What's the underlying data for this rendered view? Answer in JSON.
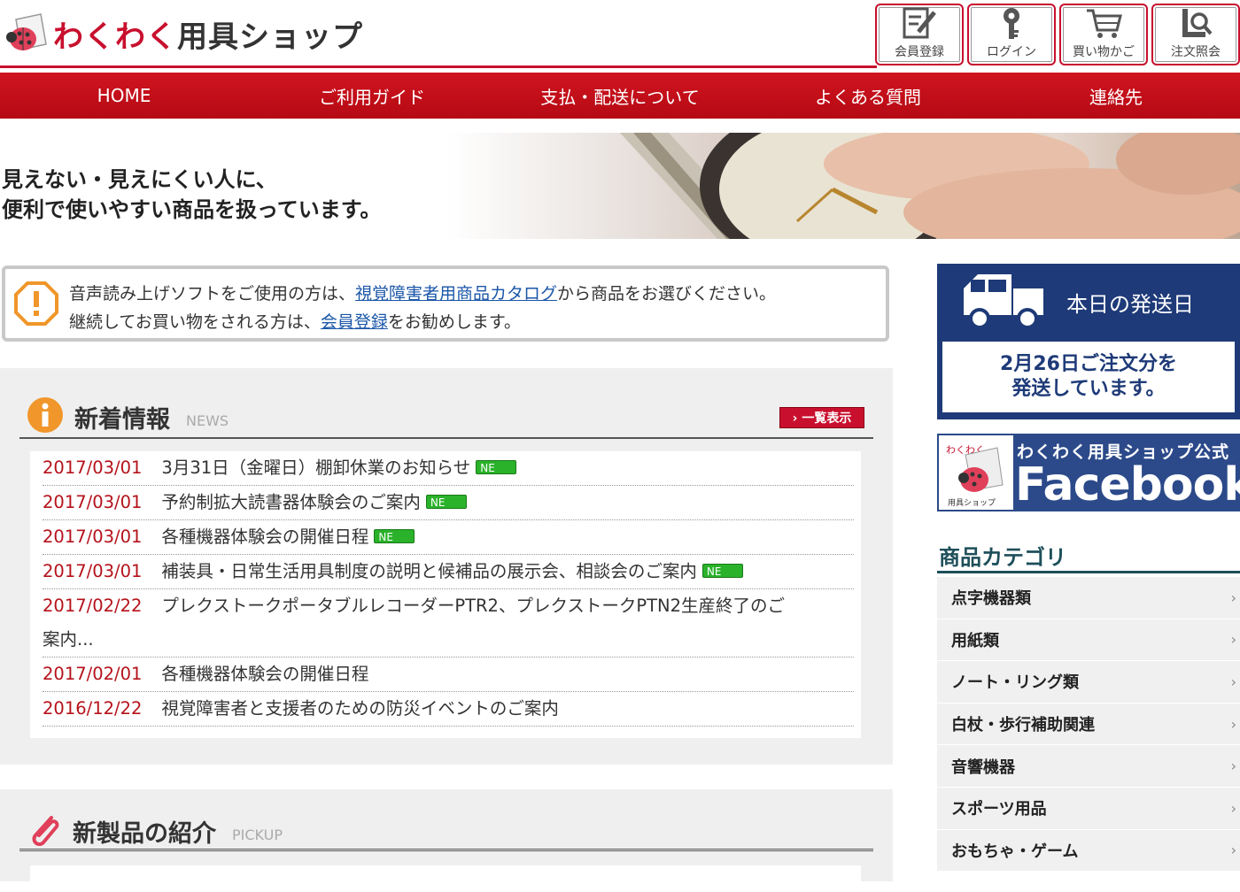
{
  "header": {
    "logo_text_accent": "わくわく",
    "logo_text_rest": "用具ショップ",
    "buttons": [
      {
        "label": "会員登録",
        "icon": "register-icon"
      },
      {
        "label": "ログイン",
        "icon": "key-icon"
      },
      {
        "label": "買い物かご",
        "icon": "cart-icon"
      },
      {
        "label": "注文照会",
        "icon": "order-search-icon"
      }
    ]
  },
  "nav": {
    "items": [
      "HOME",
      "ご利用ガイド",
      "支払・配送について",
      "よくある質問",
      "連絡先"
    ]
  },
  "hero": {
    "line1": "見えない・見えにくい人に、",
    "line2": "便利で使いやすい商品を扱っています。"
  },
  "notice": {
    "line1_pre": "音声読み上げソフトをご使用の方は、",
    "line1_link": "視覚障害者用商品カタログ",
    "line1_post": "から商品をお選びください。",
    "line2_pre": "継続してお買い物をされる方は、",
    "line2_link": "会員登録",
    "line2_post": "をお勧めします。"
  },
  "news": {
    "title": "新着情報",
    "subtitle": "NEWS",
    "more_label": "› 一覧表示",
    "new_label": "NE",
    "items": [
      {
        "date": "2017/03/01",
        "text": "3月31日（金曜日）棚卸休業のお知らせ",
        "new": true
      },
      {
        "date": "2017/03/01",
        "text": "予約制拡大読書器体験会のご案内",
        "new": true
      },
      {
        "date": "2017/03/01",
        "text": "各種機器体験会の開催日程",
        "new": true
      },
      {
        "date": "2017/03/01",
        "text": "補装具・日常生活用具制度の説明と候補品の展示会、相談会のご案内",
        "new": true
      },
      {
        "date": "2017/02/22",
        "text": "プレクストークポータブルレコーダーPTR2、プレクストークPTN2生産終了のご",
        "text2": "案内...",
        "new": false
      },
      {
        "date": "2017/02/01",
        "text": "各種機器体験会の開催日程",
        "new": false
      },
      {
        "date": "2016/12/22",
        "text": "視覚障害者と支援者のための防災イベントのご案内",
        "new": false
      }
    ]
  },
  "pickup": {
    "title": "新製品の紹介",
    "subtitle": "PICKUP"
  },
  "shipping": {
    "title": "本日の発送日",
    "line1": "2月26日ご注文分を",
    "line2": "発送しています。"
  },
  "facebook": {
    "logo_small_top": "わくわく",
    "logo_small_bottom": "用具ショップ",
    "line1": "わくわく用具ショップ公式",
    "line2": "Facebook"
  },
  "categories": {
    "title": "商品カテゴリ",
    "items": [
      "点字機器類",
      "用紙類",
      "ノート・リング類",
      "白杖・歩行補助関連",
      "音響機器",
      "スポーツ用品",
      "おもちゃ・ゲーム"
    ]
  },
  "colors": {
    "brand_red": "#c8102e",
    "navy": "#1e3a78",
    "link": "#1a56a8"
  }
}
